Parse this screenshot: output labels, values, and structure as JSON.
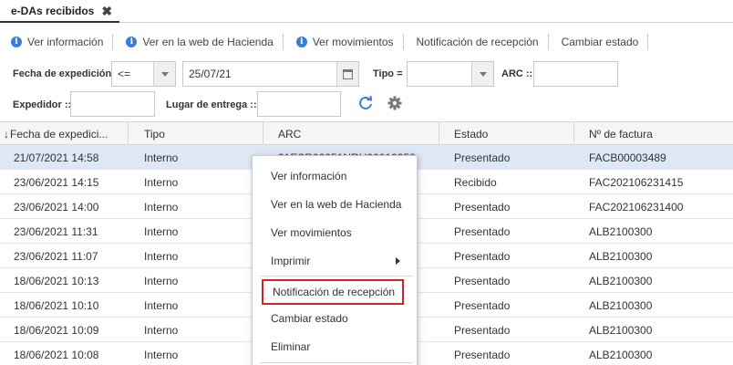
{
  "tab": {
    "label": "e-DAs recibidos",
    "close": "✖"
  },
  "toolbar": {
    "ver_informacion": "Ver información",
    "ver_web_hacienda": "Ver en la web de Hacienda",
    "ver_movimientos": "Ver movimientos",
    "notificacion_recepcion": "Notificación de recepción",
    "cambiar_estado": "Cambiar estado"
  },
  "filters": {
    "fecha_label": "Fecha de expedición",
    "fecha_operator": "<=",
    "fecha_value": "25/07/21",
    "tipo_label": "Tipo =",
    "tipo_value": "",
    "arc_label": "ARC ::",
    "arc_value": "",
    "expedidor_label": "Expedidor ::",
    "expedidor_value": "",
    "lugar_label": "Lugar de entrega ::",
    "lugar_value": ""
  },
  "grid": {
    "columns": [
      "Fecha de expedici...",
      "Tipo",
      "ARC",
      "Estado",
      "Nº de factura"
    ],
    "sort_indicator": "↓",
    "rows": [
      {
        "fecha": "21/07/2021 14:58",
        "tipo": "Interno",
        "arc": "21ESR00051NRU00012358",
        "estado": "Presentado",
        "factura": "FACB00003489",
        "selected": true
      },
      {
        "fecha": "23/06/2021 14:15",
        "tipo": "Interno",
        "arc": "",
        "estado": "Recibido",
        "factura": "FAC202106231415"
      },
      {
        "fecha": "23/06/2021 14:00",
        "tipo": "Interno",
        "arc": "",
        "estado": "Presentado",
        "factura": "FAC202106231400"
      },
      {
        "fecha": "23/06/2021 11:31",
        "tipo": "Interno",
        "arc": "",
        "estado": "Presentado",
        "factura": "ALB2100300"
      },
      {
        "fecha": "23/06/2021 11:07",
        "tipo": "Interno",
        "arc": "",
        "estado": "Presentado",
        "factura": "ALB2100300"
      },
      {
        "fecha": "18/06/2021 10:13",
        "tipo": "Interno",
        "arc": "",
        "estado": "Presentado",
        "factura": "ALB2100300"
      },
      {
        "fecha": "18/06/2021 10:10",
        "tipo": "Interno",
        "arc": "",
        "estado": "Presentado",
        "factura": "ALB2100300"
      },
      {
        "fecha": "18/06/2021 10:09",
        "tipo": "Interno",
        "arc": "",
        "estado": "Presentado",
        "factura": "ALB2100300"
      },
      {
        "fecha": "18/06/2021 10:08",
        "tipo": "Interno",
        "arc": "",
        "estado": "Presentado",
        "factura": "ALB2100300"
      }
    ]
  },
  "context_menu": {
    "items": [
      "Ver información",
      "Ver en la web de Hacienda",
      "Ver movimientos",
      "Imprimir",
      "Notificación de recepción",
      "Cambiar estado",
      "Eliminar"
    ]
  },
  "colors": {
    "accent": "#3b7dd8",
    "highlight": "#d2232a",
    "selected_row": "#dde7f5"
  }
}
